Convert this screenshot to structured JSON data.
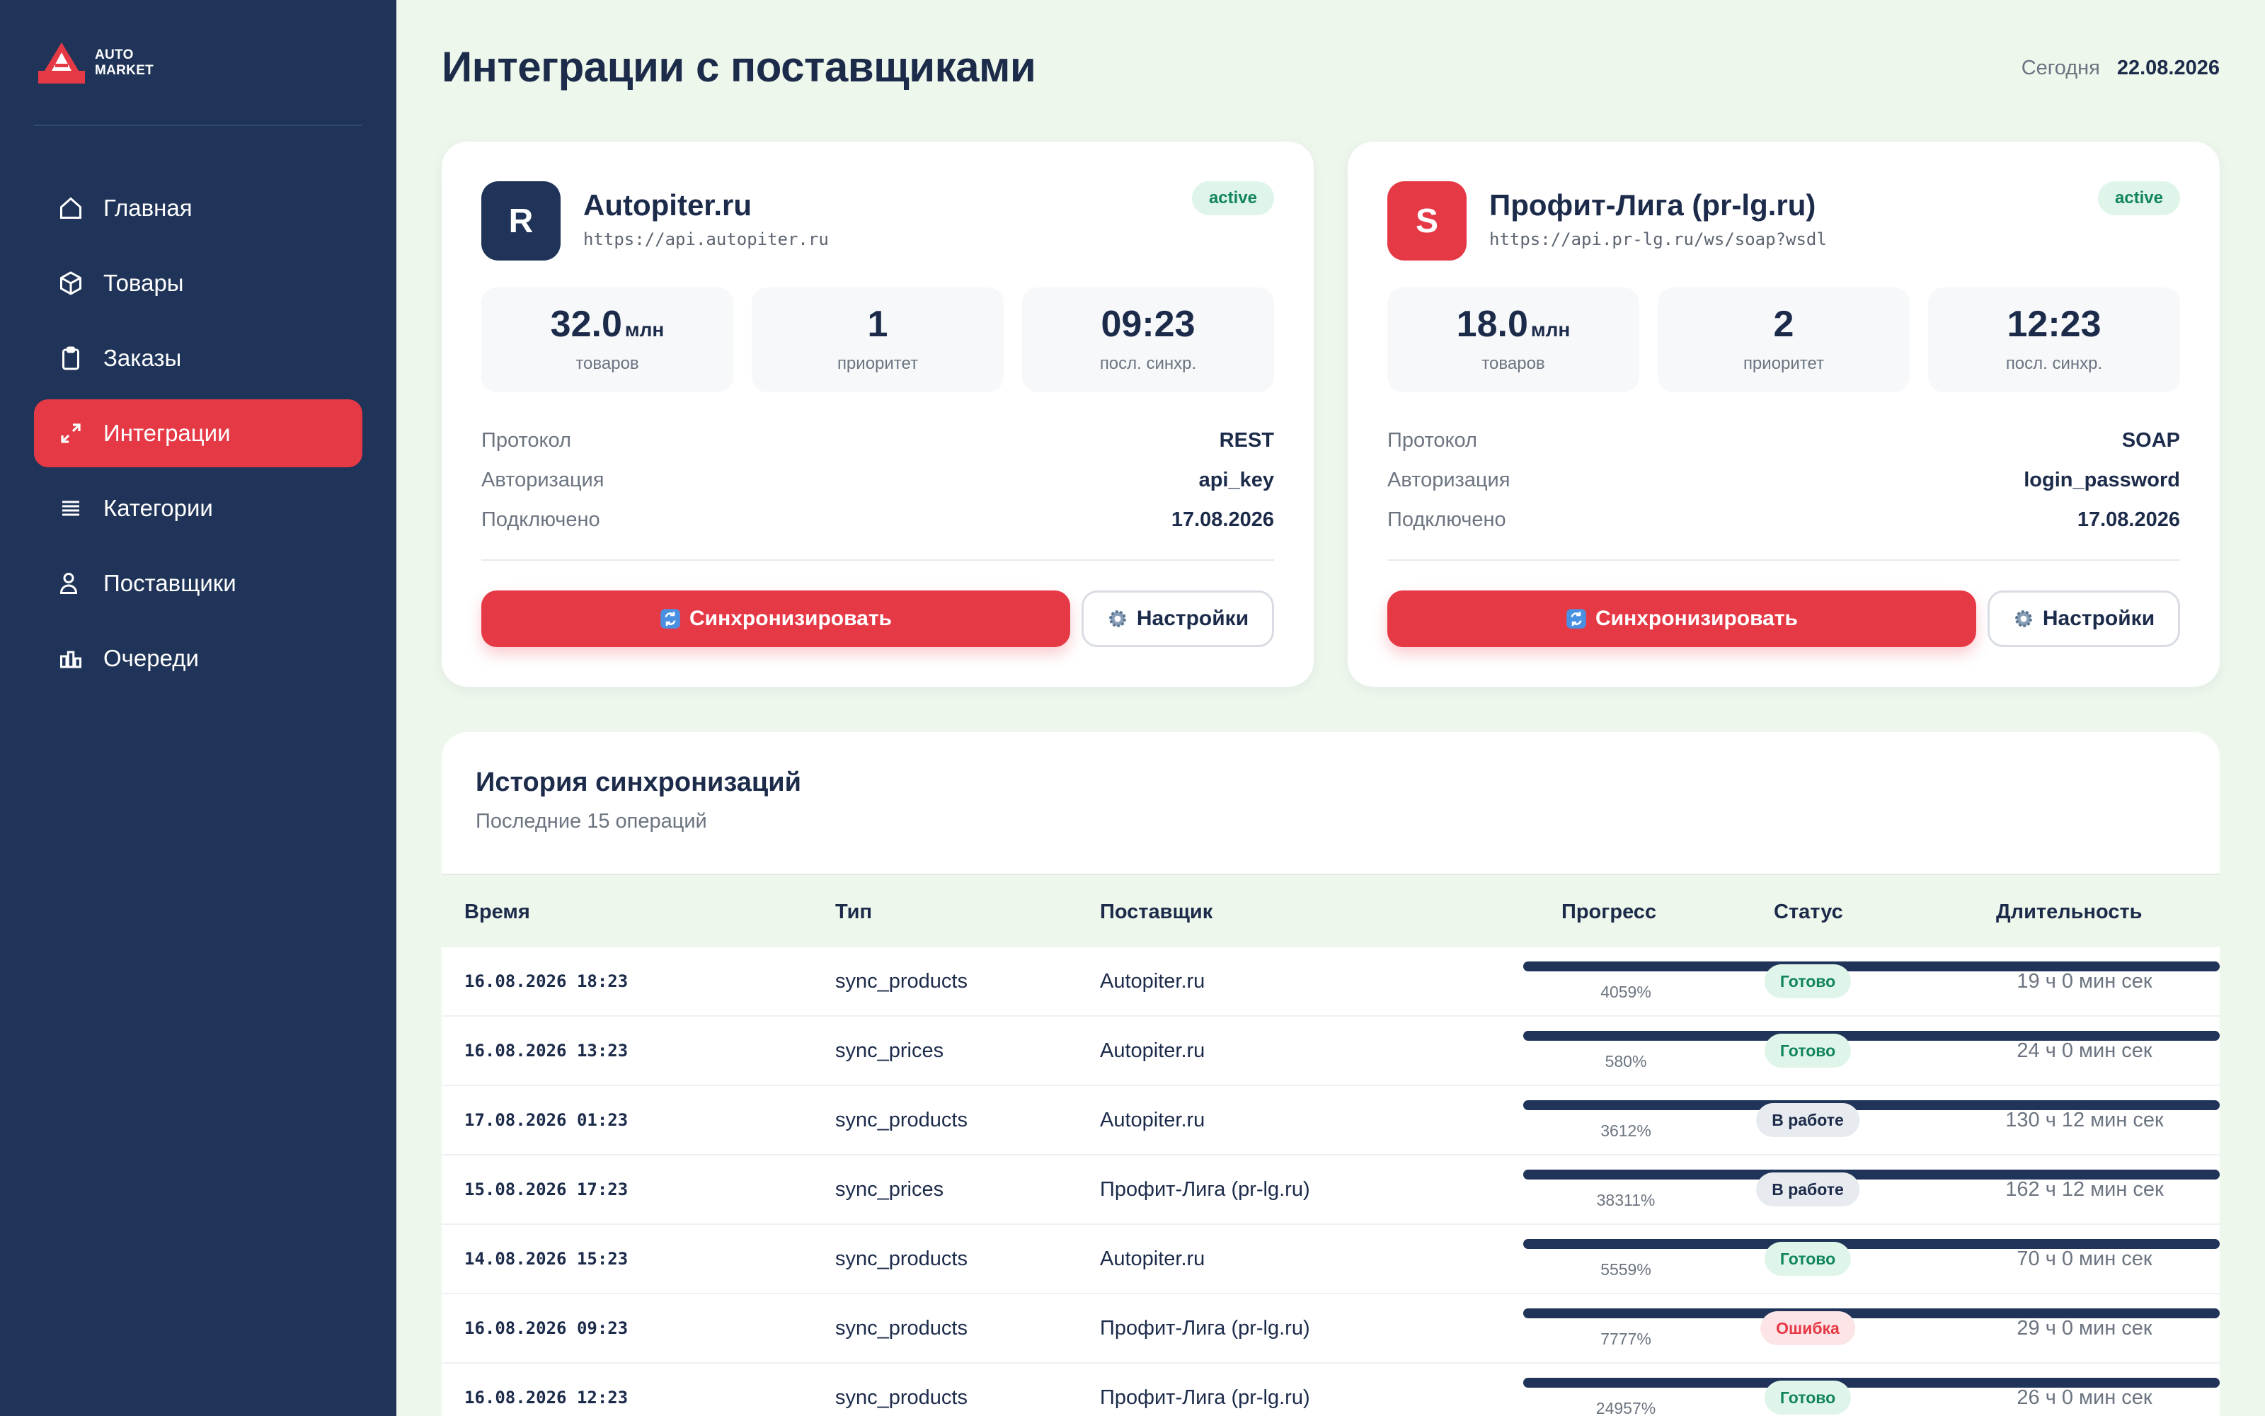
{
  "brand": {
    "line1": "AUTO",
    "line2": "MARKET"
  },
  "sidebar": {
    "items": [
      {
        "label": "Главная",
        "icon": "home-icon",
        "active": false
      },
      {
        "label": "Товары",
        "icon": "box-icon",
        "active": false
      },
      {
        "label": "Заказы",
        "icon": "clipboard-icon",
        "active": false
      },
      {
        "label": "Интеграции",
        "icon": "arrows-icon",
        "active": true
      },
      {
        "label": "Категории",
        "icon": "list-icon",
        "active": false
      },
      {
        "label": "Поставщики",
        "icon": "users-icon",
        "active": false
      },
      {
        "label": "Очереди",
        "icon": "queue-icon",
        "active": false
      }
    ]
  },
  "header": {
    "title": "Интеграции с поставщиками",
    "today_label": "Сегодня",
    "today_value": "22.08.2026"
  },
  "cards": [
    {
      "avatar": "R",
      "avatar_color": "#1f3458",
      "name": "Autopiter.ru",
      "url": "https://api.autopiter.ru",
      "status": "active",
      "stats": [
        {
          "value": "32.0",
          "unit": "млн",
          "label": "товаров"
        },
        {
          "value": "1",
          "unit": "",
          "label": "приоритет"
        },
        {
          "value": "09:23",
          "unit": "",
          "label": "посл. синхр."
        }
      ],
      "props": [
        {
          "key": "Протокол",
          "value": "REST"
        },
        {
          "key": "Авторизация",
          "value": "api_key"
        },
        {
          "key": "Подключено",
          "value": "17.08.2026"
        }
      ],
      "sync_label": "Синхронизировать",
      "settings_label": "Настройки"
    },
    {
      "avatar": "S",
      "avatar_color": "#e63946",
      "name": "Профит-Лига (pr-lg.ru)",
      "url": "https://api.pr-lg.ru/ws/soap?wsdl",
      "status": "active",
      "stats": [
        {
          "value": "18.0",
          "unit": "млн",
          "label": "товаров"
        },
        {
          "value": "2",
          "unit": "",
          "label": "приоритет"
        },
        {
          "value": "12:23",
          "unit": "",
          "label": "посл. синхр."
        }
      ],
      "props": [
        {
          "key": "Протокол",
          "value": "SOAP"
        },
        {
          "key": "Авторизация",
          "value": "login_password"
        },
        {
          "key": "Подключено",
          "value": "17.08.2026"
        }
      ],
      "sync_label": "Синхронизировать",
      "settings_label": "Настройки"
    }
  ],
  "history": {
    "title": "История синхронизаций",
    "subtitle": "Последние 15 операций",
    "columns": [
      "Время",
      "Тип",
      "Поставщик",
      "Прогресс",
      "Статус",
      "Длительность"
    ],
    "status_colors": {
      "Готово": {
        "bg": "#dff5ea",
        "fg": "#12855a"
      },
      "В работе": {
        "bg": "#e7eaee",
        "fg": "#1c2b4a"
      },
      "Ошибка": {
        "bg": "#fde4e6",
        "fg": "#e63946"
      }
    },
    "rows": [
      {
        "time": "16.08.2026 18:23",
        "type": "sync_products",
        "supplier": "Autopiter.ru",
        "progress": "4059%",
        "status": "Готово",
        "duration": "19 ч 0 мин сек"
      },
      {
        "time": "16.08.2026 13:23",
        "type": "sync_prices",
        "supplier": "Autopiter.ru",
        "progress": "580%",
        "status": "Готово",
        "duration": "24 ч 0 мин сек"
      },
      {
        "time": "17.08.2026 01:23",
        "type": "sync_products",
        "supplier": "Autopiter.ru",
        "progress": "3612%",
        "status": "В работе",
        "duration": "130 ч 12 мин сек"
      },
      {
        "time": "15.08.2026 17:23",
        "type": "sync_prices",
        "supplier": "Профит-Лига (pr-lg.ru)",
        "progress": "38311%",
        "status": "В работе",
        "duration": "162 ч 12 мин сек"
      },
      {
        "time": "14.08.2026 15:23",
        "type": "sync_products",
        "supplier": "Autopiter.ru",
        "progress": "5559%",
        "status": "Готово",
        "duration": "70 ч 0 мин сек"
      },
      {
        "time": "16.08.2026 09:23",
        "type": "sync_products",
        "supplier": "Профит-Лига (pr-lg.ru)",
        "progress": "7777%",
        "status": "Ошибка",
        "duration": "29 ч 0 мин сек"
      },
      {
        "time": "16.08.2026 12:23",
        "type": "sync_products",
        "supplier": "Профит-Лига (pr-lg.ru)",
        "progress": "24957%",
        "status": "Готово",
        "duration": "26 ч 0 мин сек"
      }
    ]
  }
}
